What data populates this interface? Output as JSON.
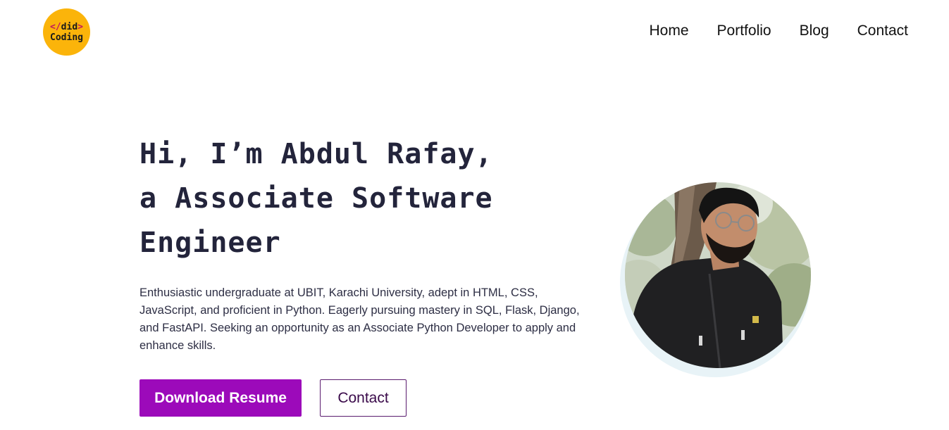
{
  "brand": {
    "logo_line1_open": "</",
    "logo_line1_word": "did",
    "logo_line1_close": ">",
    "logo_line2": "Coding"
  },
  "nav": {
    "home": "Home",
    "portfolio": "Portfolio",
    "blog": "Blog",
    "contact": "Contact"
  },
  "hero": {
    "title_line1": "Hi, I’m Abdul Rafay,",
    "title_line2": "a Associate Software",
    "title_line3": "Engineer",
    "description": "Enthusiastic undergraduate at UBIT, Karachi University, adept in HTML, CSS, JavaScript, and proficient in Python. Eagerly pursuing mastery in SQL, Flask, Django, and FastAPI. Seeking an opportunity as an Associate Python Developer to apply and enhance skills.",
    "primary_button": "Download Resume",
    "secondary_button": "Contact"
  },
  "colors": {
    "logo_bg": "#fbb40a",
    "primary": "#9c0aba",
    "title": "#23243b",
    "ring": "#e8f3f7"
  },
  "icons": {
    "profile": "profile-photo"
  }
}
